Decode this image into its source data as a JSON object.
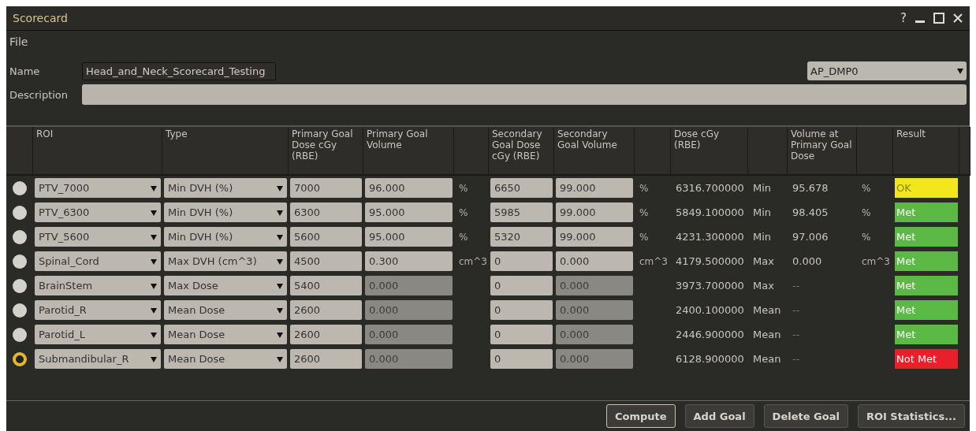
{
  "window": {
    "title": "Scorecard",
    "controls": [
      "?"
    ]
  },
  "menu": [
    "File"
  ],
  "name": {
    "label": "Name",
    "value": "Head_and_Neck_Scorecard_Testing"
  },
  "plan": {
    "value": "AP_DMP0"
  },
  "description": {
    "label": "Description"
  },
  "table": {
    "columns": [
      "ROI",
      "Type",
      "Primary Goal Dose cGy (RBE)",
      "Primary Goal Volume",
      "",
      "Secondary Goal Dose cGy (RBE)",
      "Secondary Goal Volume",
      "",
      "Dose cGy (RBE)",
      "",
      "Volume at Primary Goal Dose",
      "",
      "Result"
    ],
    "rows": [
      {
        "selected": false,
        "roi": "PTV_7000",
        "type": "Min DVH (%)",
        "primary_dose": "7000",
        "primary_volume": "96.000",
        "volume_disabled": false,
        "primary_unit": "%",
        "secondary_dose": "6650",
        "secondary_volume": "99.000",
        "secondary_unit": "%",
        "dose": "6316.700000",
        "stat": "Min",
        "volume": "95.678",
        "volume_unit": "%",
        "result": {
          "text": "OK",
          "color": "#f2e61c"
        }
      },
      {
        "selected": false,
        "roi": "PTV_6300",
        "type": "Min DVH (%)",
        "primary_dose": "6300",
        "primary_volume": "95.000",
        "volume_disabled": false,
        "primary_unit": "%",
        "secondary_dose": "5985",
        "secondary_volume": "99.000",
        "secondary_unit": "%",
        "dose": "5849.100000",
        "stat": "Min",
        "volume": "98.405",
        "volume_unit": "%",
        "result": {
          "text": "Met",
          "color": "#5cb946"
        }
      },
      {
        "selected": false,
        "roi": "PTV_5600",
        "type": "Min DVH (%)",
        "primary_dose": "5600",
        "primary_volume": "95.000",
        "volume_disabled": false,
        "primary_unit": "%",
        "secondary_dose": "5320",
        "secondary_volume": "99.000",
        "secondary_unit": "%",
        "dose": "4231.300000",
        "stat": "Min",
        "volume": "97.006",
        "volume_unit": "%",
        "result": {
          "text": "Met",
          "color": "#5cb946"
        }
      },
      {
        "selected": false,
        "roi": "Spinal_Cord",
        "type": "Max DVH (cm^3)",
        "primary_dose": "4500",
        "primary_volume": "0.300",
        "volume_disabled": false,
        "primary_unit": "cm^3",
        "secondary_dose": "0",
        "secondary_volume": "0.000",
        "secondary_unit": "cm^3",
        "dose": "4179.500000",
        "stat": "Max",
        "volume": "0.000",
        "volume_unit": "cm^3",
        "result": {
          "text": "Met",
          "color": "#5cb946"
        }
      },
      {
        "selected": false,
        "roi": "BrainStem",
        "type": "Max Dose",
        "primary_dose": "5400",
        "primary_volume": "0.000",
        "volume_disabled": true,
        "secondary_dose": "0",
        "secondary_volume": "0.000",
        "dose": "3973.700000",
        "stat": "Max",
        "volume": "--",
        "result": {
          "text": "Met",
          "color": "#5cb946"
        }
      },
      {
        "selected": false,
        "roi": "Parotid_R",
        "type": "Mean Dose",
        "primary_dose": "2600",
        "primary_volume": "0.000",
        "volume_disabled": true,
        "secondary_dose": "0",
        "secondary_volume": "0.000",
        "dose": "2400.100000",
        "stat": "Mean",
        "volume": "--",
        "result": {
          "text": "Met",
          "color": "#5cb946"
        }
      },
      {
        "selected": false,
        "roi": "Parotid_L",
        "type": "Mean Dose",
        "primary_dose": "2600",
        "primary_volume": "0.000",
        "volume_disabled": true,
        "secondary_dose": "0",
        "secondary_volume": "0.000",
        "dose": "2446.900000",
        "stat": "Mean",
        "volume": "--",
        "result": {
          "text": "Met",
          "color": "#5cb946"
        }
      },
      {
        "selected": true,
        "roi": "Submandibular_R",
        "type": "Mean Dose",
        "primary_dose": "2600",
        "primary_volume": "0.000",
        "volume_disabled": true,
        "secondary_dose": "0",
        "secondary_volume": "0.000",
        "dose": "6128.900000",
        "stat": "Mean",
        "volume": "--",
        "result": {
          "text": "Not Met",
          "color": "#e8202a"
        }
      }
    ]
  },
  "buttons": [
    {
      "label": "Compute",
      "selected": true
    },
    {
      "label": "Add Goal",
      "selected": false
    },
    {
      "label": "Delete Goal",
      "selected": false
    },
    {
      "label": "ROI Statistics...",
      "selected": false
    }
  ]
}
